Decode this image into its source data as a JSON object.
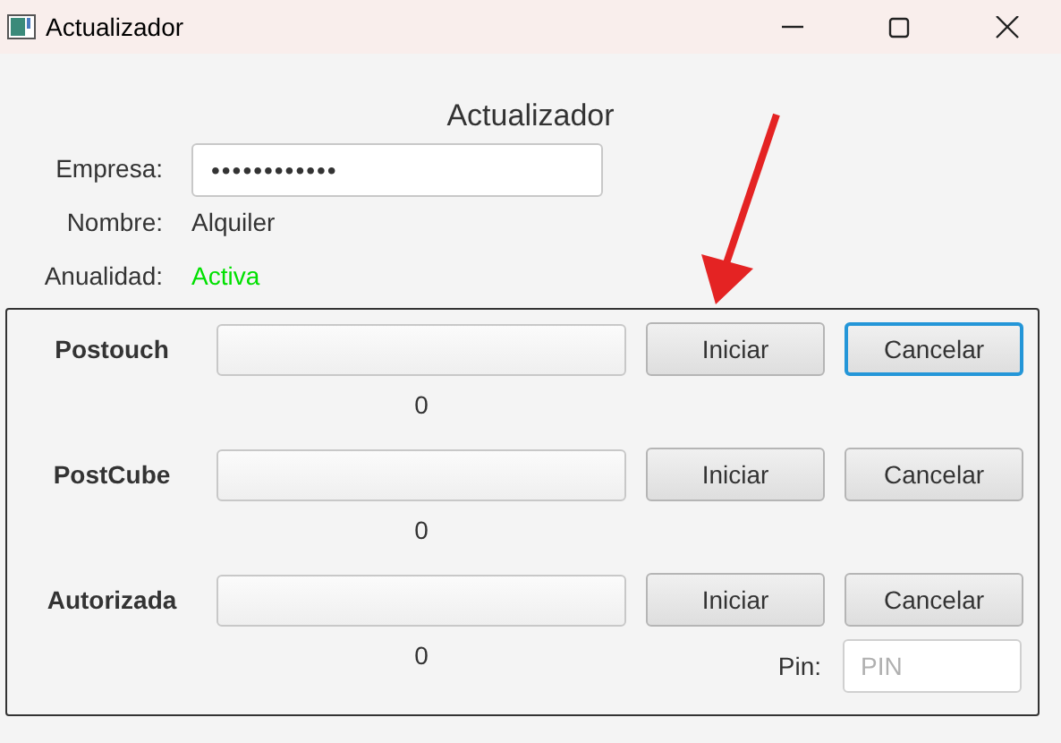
{
  "window": {
    "title": "Actualizador"
  },
  "heading": "Actualizador",
  "fields": [
    {
      "kind": "password",
      "label": "Empresa:",
      "value": "••••••••••••"
    },
    {
      "kind": "text",
      "label": "Nombre:",
      "value": "Alquiler"
    },
    {
      "kind": "status",
      "label": "Anualidad:",
      "value": "Activa",
      "color": "#00e000"
    }
  ],
  "updates": [
    {
      "name": "Postouch",
      "level": 0,
      "count": "0",
      "buttons": [
        {
          "label": "Iniciar",
          "focused": false
        },
        {
          "label": "Cancelar",
          "focused": true
        }
      ]
    },
    {
      "name": "PostCube",
      "level": 0,
      "count": "0",
      "buttons": [
        {
          "label": "Iniciar",
          "focused": false
        },
        {
          "label": "Cancelar",
          "focused": false
        }
      ]
    },
    {
      "name": "Autorizada",
      "level": 0,
      "count": "0",
      "buttons": [
        {
          "label": "Iniciar",
          "focused": false
        },
        {
          "label": "Cancelar",
          "focused": false
        }
      ]
    }
  ],
  "pin": {
    "label": "Pin:",
    "placeholder": "PIN"
  }
}
